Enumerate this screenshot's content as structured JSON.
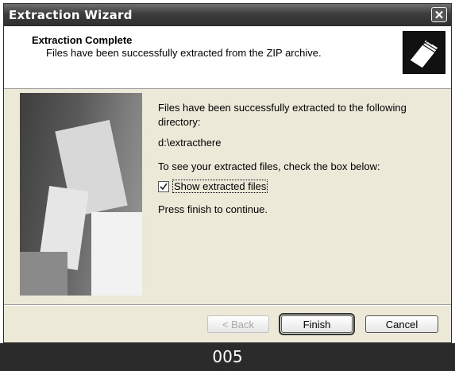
{
  "window": {
    "title": "Extraction Wizard",
    "close_label": "✕"
  },
  "header": {
    "title": "Extraction Complete",
    "subtitle": "Files have been successfully extracted from the ZIP archive."
  },
  "content": {
    "message": "Files have been successfully extracted to the following directory:",
    "directory": "d:\\extracthere",
    "instruction": "To see your extracted files, check the box below:",
    "checkbox_label": "Show extracted files",
    "checkbox_checked": true,
    "continue_text": "Press finish to continue."
  },
  "buttons": {
    "back_label": "< Back",
    "finish_label": "Finish",
    "cancel_label": "Cancel"
  },
  "page_number": "005",
  "icons": {
    "header": "folder-stack-icon",
    "close": "close-icon",
    "check": "checkmark-icon"
  }
}
